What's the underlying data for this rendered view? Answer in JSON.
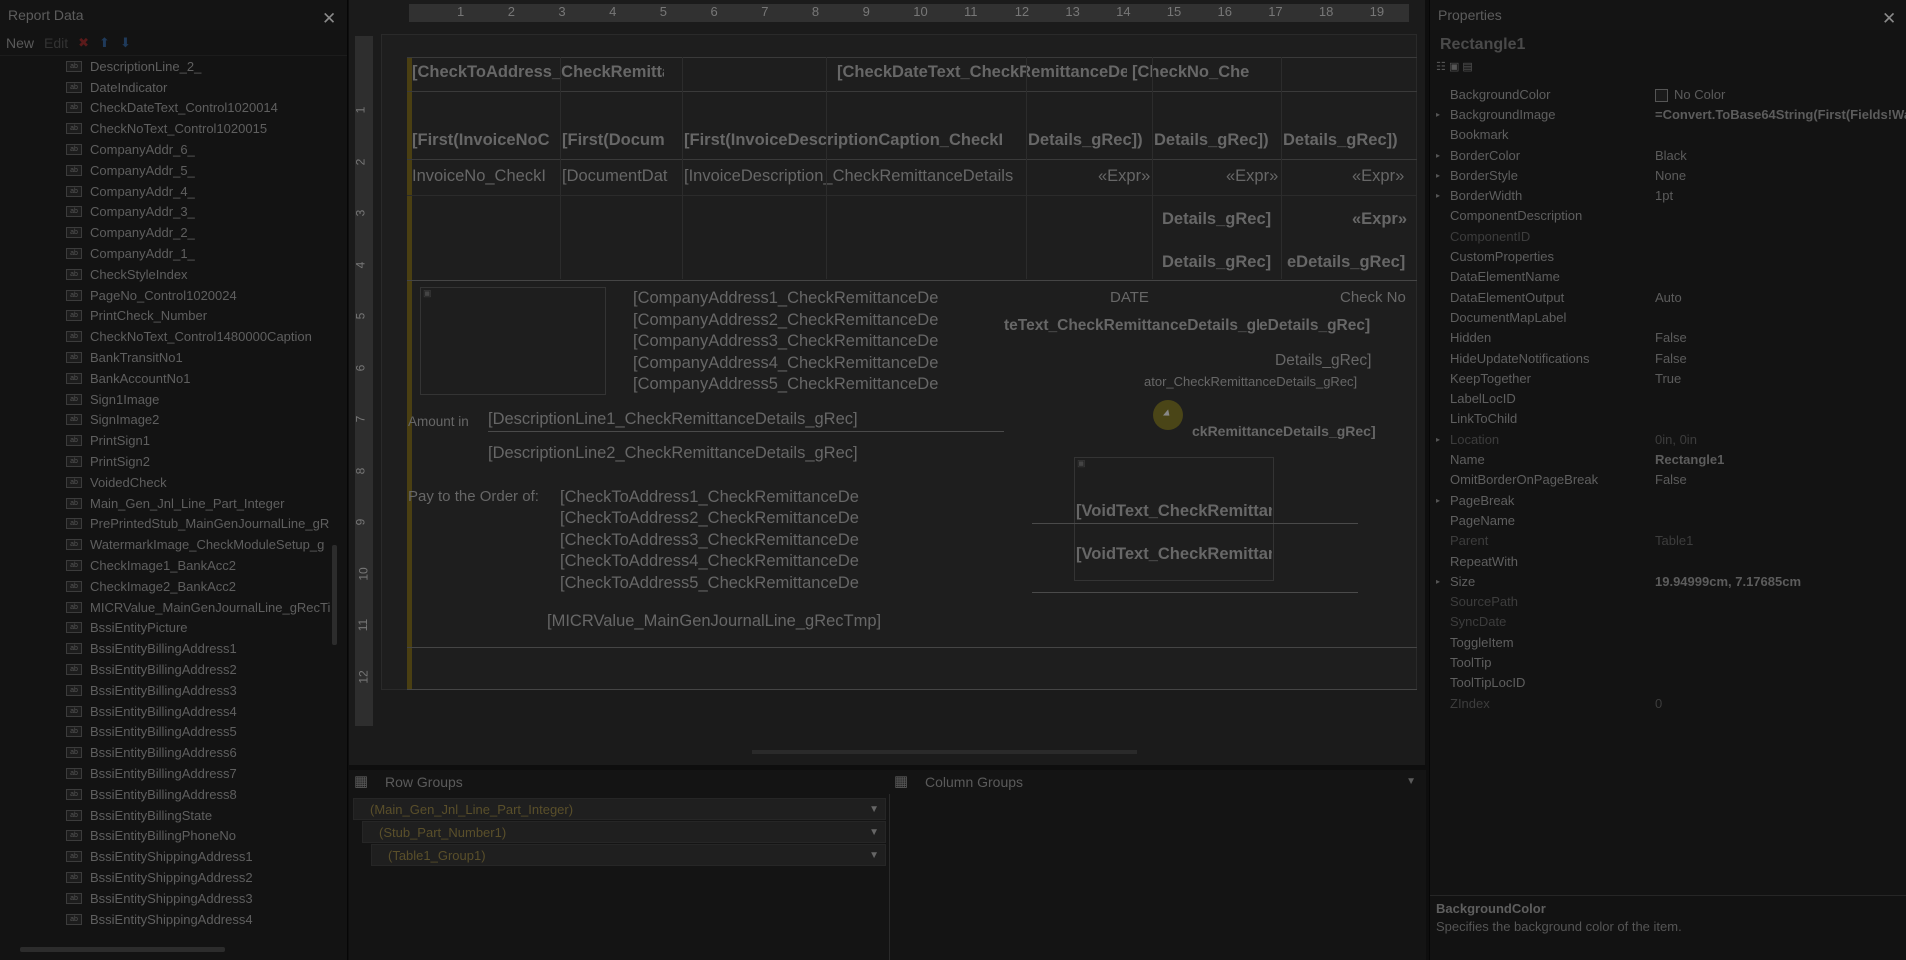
{
  "left": {
    "title": "Report Data",
    "new_label": "New",
    "edit_label": "Edit",
    "fields": [
      "DescriptionLine_2_",
      "DateIndicator",
      "CheckDateText_Control1020014",
      "CheckNoText_Control1020015",
      "CompanyAddr_6_",
      "CompanyAddr_5_",
      "CompanyAddr_4_",
      "CompanyAddr_3_",
      "CompanyAddr_2_",
      "CompanyAddr_1_",
      "CheckStyleIndex",
      "PageNo_Control1020024",
      "PrintCheck_Number",
      "CheckNoText_Control1480000Caption",
      "BankTransitNo1",
      "BankAccountNo1",
      "Sign1Image",
      "SignImage2",
      "PrintSign1",
      "PrintSign2",
      "VoidedCheck",
      "Main_Gen_Jnl_Line_Part_Integer",
      "PrePrintedStub_MainGenJournalLine_gR",
      "WatermarkImage_CheckModuleSetup_g",
      "CheckImage1_BankAcc2",
      "CheckImage2_BankAcc2",
      "MICRValue_MainGenJournalLine_gRecTi",
      "BssiEntityPicture",
      "BssiEntityBillingAddress1",
      "BssiEntityBillingAddress2",
      "BssiEntityBillingAddress3",
      "BssiEntityBillingAddress4",
      "BssiEntityBillingAddress5",
      "BssiEntityBillingAddress6",
      "BssiEntityBillingAddress7",
      "BssiEntityBillingAddress8",
      "BssiEntityBillingState",
      "BssiEntityBillingPhoneNo",
      "BssiEntityShippingAddress1",
      "BssiEntityShippingAddress2",
      "BssiEntityShippingAddress3",
      "BssiEntityShippingAddress4"
    ]
  },
  "ruler": {
    "cols": [
      "1",
      "2",
      "3",
      "4",
      "5",
      "6",
      "7",
      "8",
      "9",
      "10",
      "11",
      "12",
      "13",
      "14",
      "15",
      "16",
      "17",
      "18",
      "19"
    ],
    "rows": [
      "1",
      "2",
      "3",
      "4",
      "5",
      "6",
      "7",
      "8",
      "9",
      "10",
      "11",
      "12"
    ]
  },
  "report": {
    "hdr_checkto": "[CheckToAddress_CheckRemittance",
    "hdr_checkdate": "[CheckDateText_CheckRemittanceDetails_gRec]",
    "hdr_checkno": "[CheckNo_Che",
    "col1_caption": "[First(InvoiceNoC",
    "col2_caption": "[First(Docum",
    "col3_caption": "[First(InvoiceDescriptionCaption_CheckI",
    "col4_caption": "Details_gRec])",
    "col5_caption": "Details_gRec])",
    "col6_caption": "Details_gRec])",
    "row1_c1": "InvoiceNo_CheckI",
    "row1_c2": "[DocumentDat",
    "row1_c3": "[InvoiceDescription_CheckRemittanceDetails",
    "row1_c4": "«Expr»",
    "row1_c5": "«Expr»",
    "row1_c6": "«Expr»",
    "row2_c5": "Details_gRec]",
    "row2_c6": "«Expr»",
    "row3_c5": "Details_gRec]",
    "row3_c6": "eDetails_gRec]",
    "company1": "[CompanyAddress1_CheckRemittanceDe",
    "company2": "[CompanyAddress2_CheckRemittanceDe",
    "company3": "[CompanyAddress3_CheckRemittanceDe",
    "company4": "[CompanyAddress4_CheckRemittanceDe",
    "company5": "[CompanyAddress5_CheckRemittanceDe",
    "date_label": "DATE",
    "checkno_label": "Check No",
    "datetext": "teText_CheckRemittanceDetails_gRec]",
    "checkno_val": "eDetails_gRec]",
    "details_val": "Details_gRec]",
    "ator_val": "ator_CheckRemittanceDetails_gRec]",
    "kremit_val": "ckRemittanceDetails_gRec]",
    "amount_in": "Amount in",
    "desc1": "[DescriptionLine1_CheckRemittanceDetails_gRec]",
    "desc2": "[DescriptionLine2_CheckRemittanceDetails_gRec]",
    "pay_to": "Pay to the Order of:",
    "checkto1": "[CheckToAddress1_CheckRemittanceDe",
    "checkto2": "[CheckToAddress2_CheckRemittanceDe",
    "checkto3": "[CheckToAddress3_CheckRemittanceDe",
    "checkto4": "[CheckToAddress4_CheckRemittanceDe",
    "checkto5": "[CheckToAddress5_CheckRemittanceDe",
    "void1": "[VoidText_CheckRemittanc",
    "void2": "[VoidText_CheckRemittanc",
    "micr": "[MICRValue_MainGenJournalLine_gRecTmp]"
  },
  "groups": {
    "row_title": "Row Groups",
    "col_title": "Column Groups",
    "rows": [
      "(Main_Gen_Jnl_Line_Part_Integer)",
      "(Stub_Part_Number1)",
      "(Table1_Group1)"
    ]
  },
  "props": {
    "title": "Properties",
    "object": "Rectangle1",
    "items": [
      {
        "name": "BackgroundColor",
        "value": "No Color",
        "swatch": true
      },
      {
        "name": "BackgroundImage",
        "value": "=Convert.ToBase64String(First(Fields!Wa",
        "bold": true,
        "exp": true
      },
      {
        "name": "Bookmark",
        "value": ""
      },
      {
        "name": "BorderColor",
        "value": "Black",
        "exp": true
      },
      {
        "name": "BorderStyle",
        "value": "None",
        "exp": true
      },
      {
        "name": "BorderWidth",
        "value": "1pt",
        "exp": true
      },
      {
        "name": "ComponentDescription",
        "value": ""
      },
      {
        "name": "ComponentID",
        "value": "",
        "dis": true
      },
      {
        "name": "CustomProperties",
        "value": ""
      },
      {
        "name": "DataElementName",
        "value": ""
      },
      {
        "name": "DataElementOutput",
        "value": "Auto"
      },
      {
        "name": "DocumentMapLabel",
        "value": ""
      },
      {
        "name": "Hidden",
        "value": "False"
      },
      {
        "name": "HideUpdateNotifications",
        "value": "False"
      },
      {
        "name": "KeepTogether",
        "value": "True"
      },
      {
        "name": "LabelLocID",
        "value": ""
      },
      {
        "name": "LinkToChild",
        "value": ""
      },
      {
        "name": "Location",
        "value": "0in, 0in",
        "dis": true,
        "exp": true
      },
      {
        "name": "Name",
        "value": "Rectangle1",
        "bold": true
      },
      {
        "name": "OmitBorderOnPageBreak",
        "value": "False"
      },
      {
        "name": "PageBreak",
        "value": "",
        "exp": true
      },
      {
        "name": "PageName",
        "value": ""
      },
      {
        "name": "Parent",
        "value": "Table1",
        "dis": true
      },
      {
        "name": "RepeatWith",
        "value": ""
      },
      {
        "name": "Size",
        "value": "19.94999cm, 7.17685cm",
        "bold": true,
        "exp": true
      },
      {
        "name": "SourcePath",
        "value": "",
        "dis": true
      },
      {
        "name": "SyncDate",
        "value": "",
        "dis": true
      },
      {
        "name": "ToggleItem",
        "value": ""
      },
      {
        "name": "ToolTip",
        "value": ""
      },
      {
        "name": "ToolTipLocID",
        "value": ""
      },
      {
        "name": "ZIndex",
        "value": "0",
        "dis": true
      }
    ],
    "desc_name": "BackgroundColor",
    "desc_text": "Specifies the background color of the item."
  }
}
